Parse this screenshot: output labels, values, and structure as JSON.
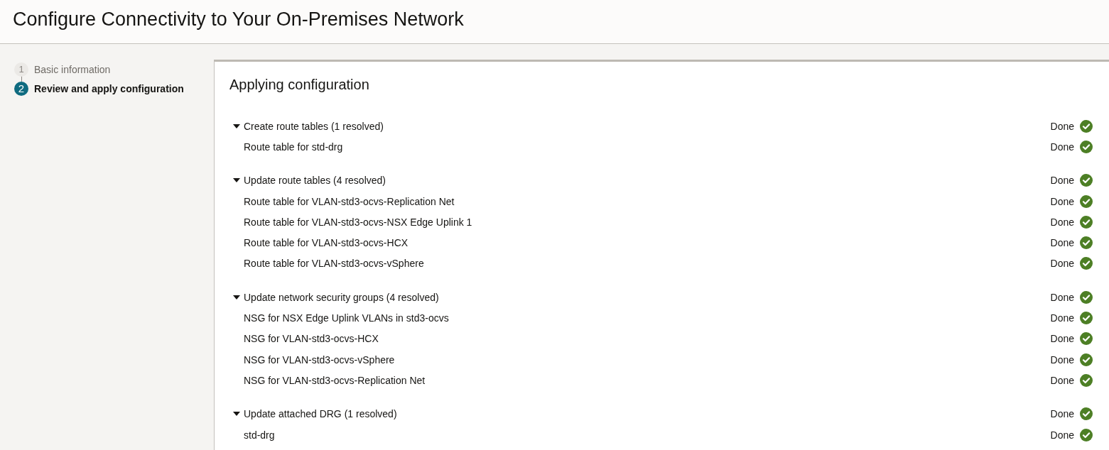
{
  "page_title": "Configure Connectivity to Your On-Premises Network",
  "steps": [
    {
      "number": "1",
      "label": "Basic information",
      "selected": false
    },
    {
      "number": "2",
      "label": "Review and apply configuration",
      "selected": true
    }
  ],
  "panel": {
    "title": "Applying configuration",
    "groups": [
      {
        "label": "Create route tables (1 resolved)",
        "expanded": true,
        "status": "Done",
        "items": [
          {
            "label": "Route table for std-drg",
            "status": "Done"
          }
        ]
      },
      {
        "label": "Update route tables (4 resolved)",
        "expanded": true,
        "status": "Done",
        "items": [
          {
            "label": "Route table for VLAN-std3-ocvs-Replication Net",
            "status": "Done"
          },
          {
            "label": "Route table for VLAN-std3-ocvs-NSX Edge Uplink 1",
            "status": "Done"
          },
          {
            "label": "Route table for VLAN-std3-ocvs-HCX",
            "status": "Done"
          },
          {
            "label": "Route table for VLAN-std3-ocvs-vSphere",
            "status": "Done"
          }
        ]
      },
      {
        "label": "Update network security groups (4 resolved)",
        "expanded": true,
        "status": "Done",
        "items": [
          {
            "label": "NSG for NSX Edge Uplink VLANs in std3-ocvs",
            "status": "Done"
          },
          {
            "label": "NSG for VLAN-std3-ocvs-HCX",
            "status": "Done"
          },
          {
            "label": "NSG for VLAN-std3-ocvs-vSphere",
            "status": "Done"
          },
          {
            "label": "NSG for VLAN-std3-ocvs-Replication Net",
            "status": "Done"
          }
        ]
      },
      {
        "label": "Update attached DRG (1 resolved)",
        "expanded": true,
        "status": "Done",
        "items": [
          {
            "label": "std-drg",
            "status": "Done"
          }
        ]
      }
    ]
  }
}
